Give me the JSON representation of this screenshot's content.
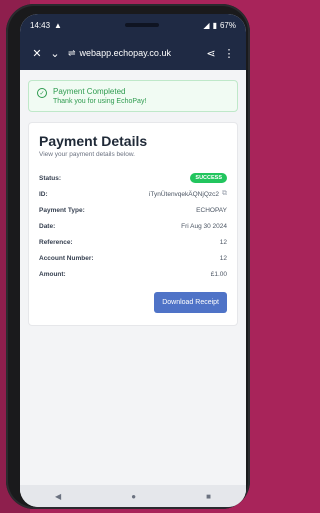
{
  "status_bar": {
    "time": "14:43",
    "battery": "67%"
  },
  "browser": {
    "url": "webapp.echopay.co.uk"
  },
  "alert": {
    "title": "Payment Completed",
    "subtitle": "Thank you for using EchoPay!"
  },
  "card": {
    "title": "Payment Details",
    "subtitle": "View your payment details below.",
    "rows": [
      {
        "label": "Status:",
        "value": "SUCCESS"
      },
      {
        "label": "ID:",
        "value": "iTynÜtenvqekÄQNjQzc2"
      },
      {
        "label": "Payment Type:",
        "value": "ECHOPAY"
      },
      {
        "label": "Date:",
        "value": "Fri Aug 30 2024"
      },
      {
        "label": "Reference:",
        "value": "12"
      },
      {
        "label": "Account Number:",
        "value": "12"
      },
      {
        "label": "Amount:",
        "value": "£1.00"
      }
    ],
    "button_label": "Download Receipt"
  },
  "icons": [
    "close-icon",
    "chevron-down-icon",
    "tune-icon",
    "share-icon",
    "more-icon",
    "check-circle-icon",
    "copy-icon",
    "back-icon",
    "home-icon",
    "recents-icon"
  ]
}
